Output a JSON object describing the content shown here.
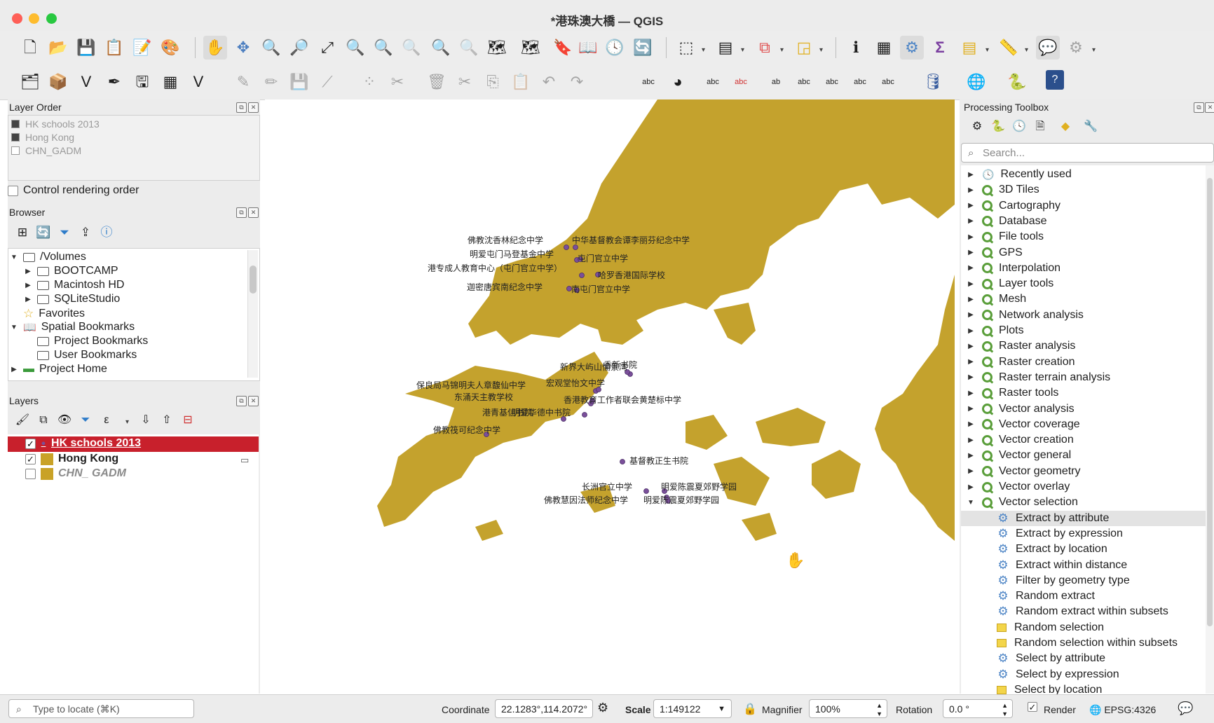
{
  "window": {
    "title": "*港珠澳大橋 — QGIS"
  },
  "layer_order": {
    "title": "Layer Order",
    "items": [
      {
        "label": "HK schools 2013",
        "checked": true
      },
      {
        "label": "Hong Kong",
        "checked": true
      },
      {
        "label": "CHN_GADM",
        "checked": false
      }
    ],
    "control_rendering_label": "Control rendering order"
  },
  "browser": {
    "title": "Browser",
    "items": [
      {
        "label": "/Volumes",
        "expanded": true
      },
      {
        "label": "BOOTCAMP"
      },
      {
        "label": "Macintosh HD"
      },
      {
        "label": "SQLiteStudio"
      },
      {
        "label": "Favorites"
      },
      {
        "label": "Spatial Bookmarks",
        "expanded": true
      },
      {
        "label": "Project Bookmarks"
      },
      {
        "label": "User Bookmarks"
      },
      {
        "label": "Project Home"
      }
    ]
  },
  "layers": {
    "title": "Layers",
    "items": [
      {
        "label": "HK schools 2013",
        "checked": true,
        "selected": true,
        "color": "#7a4f9a"
      },
      {
        "label": "Hong Kong",
        "checked": true,
        "color": "#c9a227"
      },
      {
        "label": "CHN_ GADM",
        "checked": false,
        "color": "#c9a227"
      }
    ]
  },
  "map": {
    "land_color": "#c4a22d",
    "point_color": "#7a4f9a",
    "labels": [
      "佛教沈香林纪念中学",
      "中华基督教会谭李丽芬纪念中学",
      "明爱屯门马登基金中学",
      "屯门官立中学",
      "港专成人教育中心（屯门官立中学）",
      "哈罗香港国际学校",
      "迦密唐宾南纪念中学",
      "南屯门官立中学",
      "新界大屿山愉景湾",
      "香新书院",
      "保良局马锦明夫人章馥仙中学",
      "宏观堂怡文中学",
      "东涌天主教学校",
      "香港教育工作者联会黄楚标中学",
      "港青基信书院",
      "明爱华德中书院",
      "佛教筏可纪念中学",
      "基督教正生书院",
      "长洲官立中学",
      "明爱陈震夏郊野学园",
      "佛教慧因法师纪念中学",
      "明爱陈震夏郊野学园"
    ]
  },
  "processing": {
    "title": "Processing Toolbox",
    "search_placeholder": "Search...",
    "groups": [
      "Recently used",
      "3D Tiles",
      "Cartography",
      "Database",
      "File tools",
      "GPS",
      "Interpolation",
      "Layer tools",
      "Mesh",
      "Network analysis",
      "Plots",
      "Raster analysis",
      "Raster creation",
      "Raster terrain analysis",
      "Raster tools",
      "Vector analysis",
      "Vector coverage",
      "Vector creation",
      "Vector general",
      "Vector geometry",
      "Vector overlay",
      "Vector selection"
    ],
    "algorithms": [
      {
        "label": "Extract by attribute",
        "icon": "gear",
        "selected": true
      },
      {
        "label": "Extract by expression",
        "icon": "gear"
      },
      {
        "label": "Extract by location",
        "icon": "gear"
      },
      {
        "label": "Extract within distance",
        "icon": "gear"
      },
      {
        "label": "Filter by geometry type",
        "icon": "gear"
      },
      {
        "label": "Random extract",
        "icon": "gear"
      },
      {
        "label": "Random extract within subsets",
        "icon": "gear"
      },
      {
        "label": "Random selection",
        "icon": "select"
      },
      {
        "label": "Random selection within subsets",
        "icon": "select"
      },
      {
        "label": "Select by attribute",
        "icon": "gear"
      },
      {
        "label": "Select by expression",
        "icon": "gear"
      },
      {
        "label": "Select by location",
        "icon": "select"
      }
    ]
  },
  "status": {
    "locator_placeholder": "Type to locate (⌘K)",
    "coordinate_label": "Coordinate",
    "coordinate_value": "22.1283°,114.2072°",
    "scale_label": "Scale",
    "scale_value": "1:149122",
    "magnifier_label": "Magnifier",
    "magnifier_value": "100%",
    "rotation_label": "Rotation",
    "rotation_value": "0.0 °",
    "render_label": "Render",
    "crs": "EPSG:4326"
  }
}
